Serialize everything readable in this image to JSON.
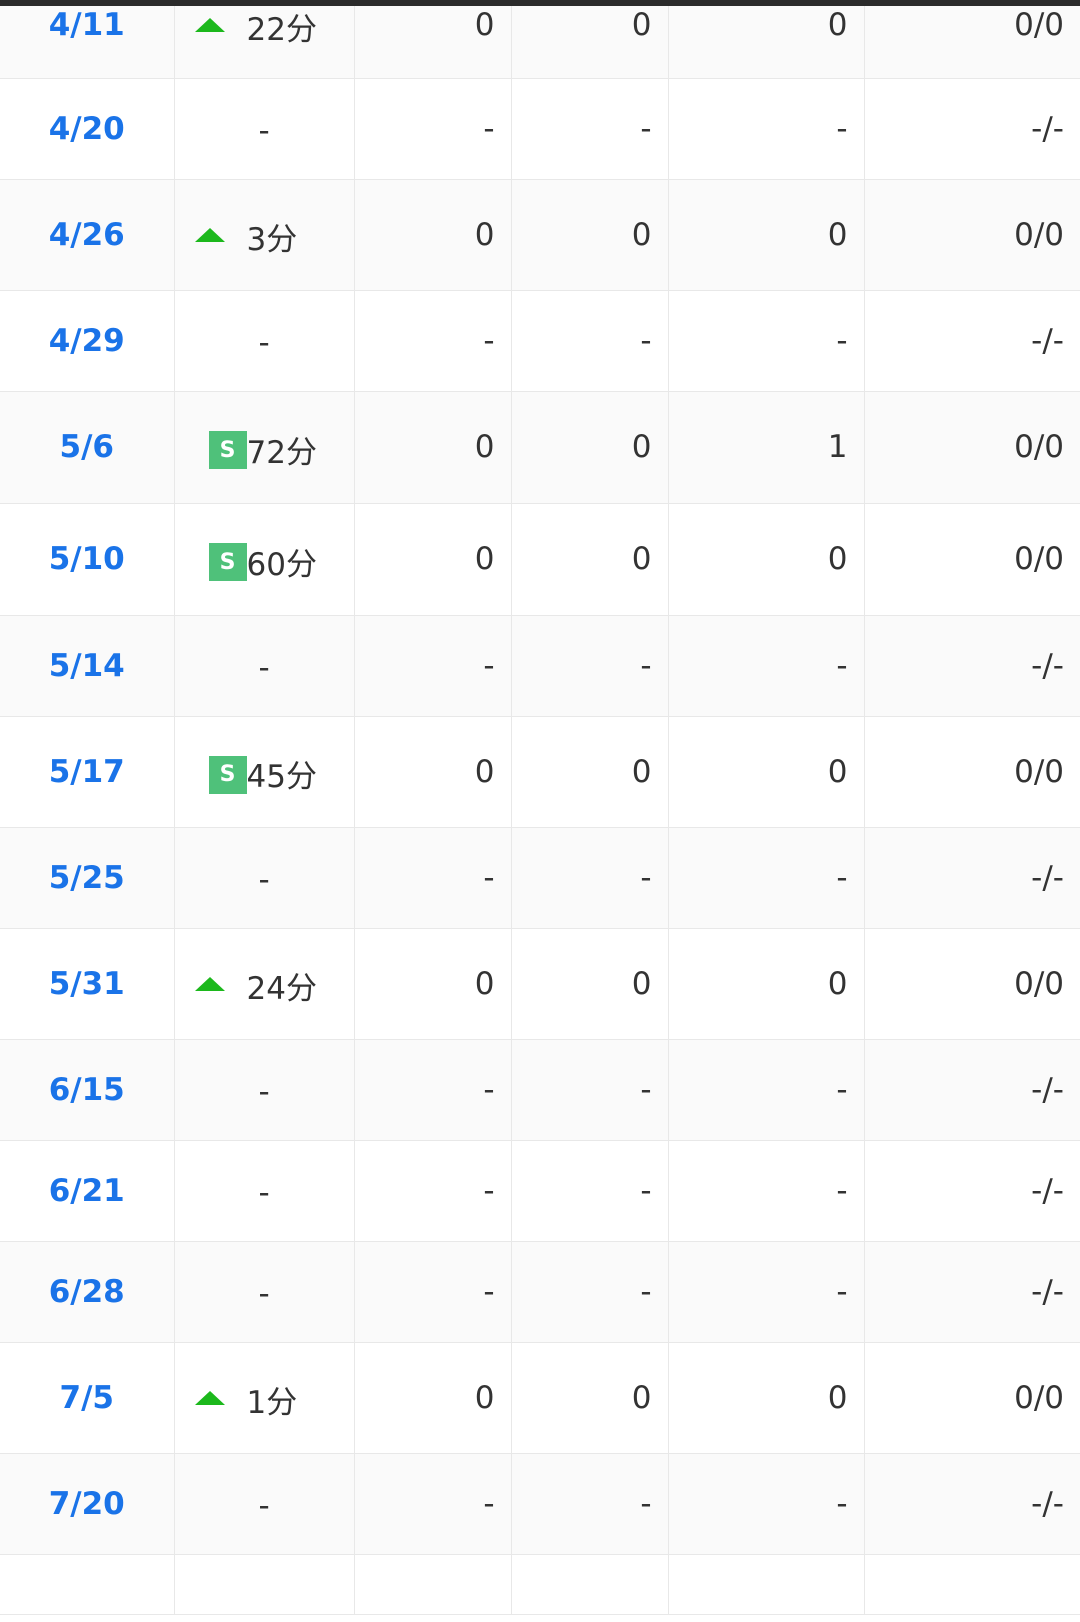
{
  "rows": [
    {
      "date": "4/11",
      "status": "up",
      "minutes": "22分",
      "v1": "0",
      "v2": "0",
      "v3": "0",
      "cards": "0/0"
    },
    {
      "date": "4/20",
      "status": "none",
      "minutes": "-",
      "v1": "-",
      "v2": "-",
      "v3": "-",
      "cards": "-/-"
    },
    {
      "date": "4/26",
      "status": "up",
      "minutes": "3分",
      "v1": "0",
      "v2": "0",
      "v3": "0",
      "cards": "0/0"
    },
    {
      "date": "4/29",
      "status": "none",
      "minutes": "-",
      "v1": "-",
      "v2": "-",
      "v3": "-",
      "cards": "-/-"
    },
    {
      "date": "5/6",
      "status": "starter",
      "minutes": "72分",
      "v1": "0",
      "v2": "0",
      "v3": "1",
      "cards": "0/0"
    },
    {
      "date": "5/10",
      "status": "starter",
      "minutes": "60分",
      "v1": "0",
      "v2": "0",
      "v3": "0",
      "cards": "0/0"
    },
    {
      "date": "5/14",
      "status": "none",
      "minutes": "-",
      "v1": "-",
      "v2": "-",
      "v3": "-",
      "cards": "-/-"
    },
    {
      "date": "5/17",
      "status": "starter",
      "minutes": "45分",
      "v1": "0",
      "v2": "0",
      "v3": "0",
      "cards": "0/0"
    },
    {
      "date": "5/25",
      "status": "none",
      "minutes": "-",
      "v1": "-",
      "v2": "-",
      "v3": "-",
      "cards": "-/-"
    },
    {
      "date": "5/31",
      "status": "up",
      "minutes": "24分",
      "v1": "0",
      "v2": "0",
      "v3": "0",
      "cards": "0/0"
    },
    {
      "date": "6/15",
      "status": "none",
      "minutes": "-",
      "v1": "-",
      "v2": "-",
      "v3": "-",
      "cards": "-/-"
    },
    {
      "date": "6/21",
      "status": "none",
      "minutes": "-",
      "v1": "-",
      "v2": "-",
      "v3": "-",
      "cards": "-/-"
    },
    {
      "date": "6/28",
      "status": "none",
      "minutes": "-",
      "v1": "-",
      "v2": "-",
      "v3": "-",
      "cards": "-/-"
    },
    {
      "date": "7/5",
      "status": "up",
      "minutes": "1分",
      "v1": "0",
      "v2": "0",
      "v3": "0",
      "cards": "0/0"
    },
    {
      "date": "7/20",
      "status": "none",
      "minutes": "-",
      "v1": "-",
      "v2": "-",
      "v3": "-",
      "cards": "-/-"
    }
  ],
  "badge_label": "S",
  "icons": {
    "up": "sub-in-arrow-icon",
    "starter": "starter-badge-icon"
  },
  "colors": {
    "date_link": "#1a73e8",
    "arrow_green": "#1cb81c",
    "badge_green": "#4fc17a",
    "text": "#333333",
    "grid": "#e8e8e8"
  }
}
